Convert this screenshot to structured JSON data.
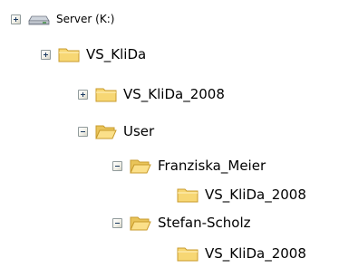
{
  "tree": {
    "nodes": [
      {
        "label": "Server (K:)",
        "state": "collapsed",
        "icon": "drive-icon"
      },
      {
        "label": "VS_KliDa",
        "state": "collapsed",
        "icon": "folder-icon"
      },
      {
        "label": "VS_KliDa_2008",
        "state": "collapsed",
        "icon": "folder-icon"
      },
      {
        "label": "User",
        "state": "expanded",
        "icon": "folder-icon"
      },
      {
        "label": "Franziska_Meier",
        "state": "expanded",
        "icon": "folder-icon"
      },
      {
        "label": "VS_KliDa_2008",
        "state": "leaf",
        "icon": "folder-icon"
      },
      {
        "label": "Stefan-Scholz",
        "state": "expanded",
        "icon": "folder-icon"
      },
      {
        "label": "VS_KliDa_2008",
        "state": "leaf",
        "icon": "folder-icon"
      }
    ]
  },
  "colors": {
    "folder_body": "#f7d774",
    "folder_outline": "#c89b2c",
    "expander_border": "#919b9c",
    "expander_glyph": "#1c3b62"
  }
}
